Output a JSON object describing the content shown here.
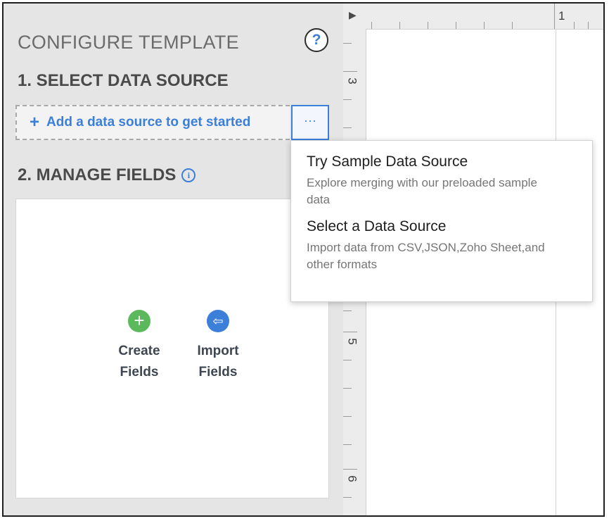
{
  "panel": {
    "title": "CONFIGURE TEMPLATE",
    "help_glyph": "?",
    "section1_title": "1. SELECT DATA SOURCE",
    "add_source_label": "Add a data source to get started",
    "more_glyph": "···",
    "section2_title": "2. MANAGE FIELDS",
    "info_glyph": "i",
    "actions": [
      {
        "label": "Create\nFields",
        "icon": "plus-circle-icon",
        "glyph": "+",
        "color": "#5cb85c"
      },
      {
        "label": "Import\nFields",
        "icon": "import-icon",
        "glyph": "⇦",
        "color": "#3b7fd9"
      }
    ]
  },
  "ruler": {
    "top_number": "1",
    "left_numbers": [
      "3",
      "5",
      "6"
    ]
  },
  "dropdown": {
    "items": [
      {
        "title": "Try Sample Data Source",
        "description": "Explore merging with our preloaded sample data"
      },
      {
        "title": "Select a Data Source",
        "description": "Import data from CSV,JSON,Zoho Sheet,and other formats"
      }
    ]
  },
  "colors": {
    "accent": "#3b7fd9",
    "success": "#5cb85c",
    "panel_bg": "#e5e5e5"
  }
}
